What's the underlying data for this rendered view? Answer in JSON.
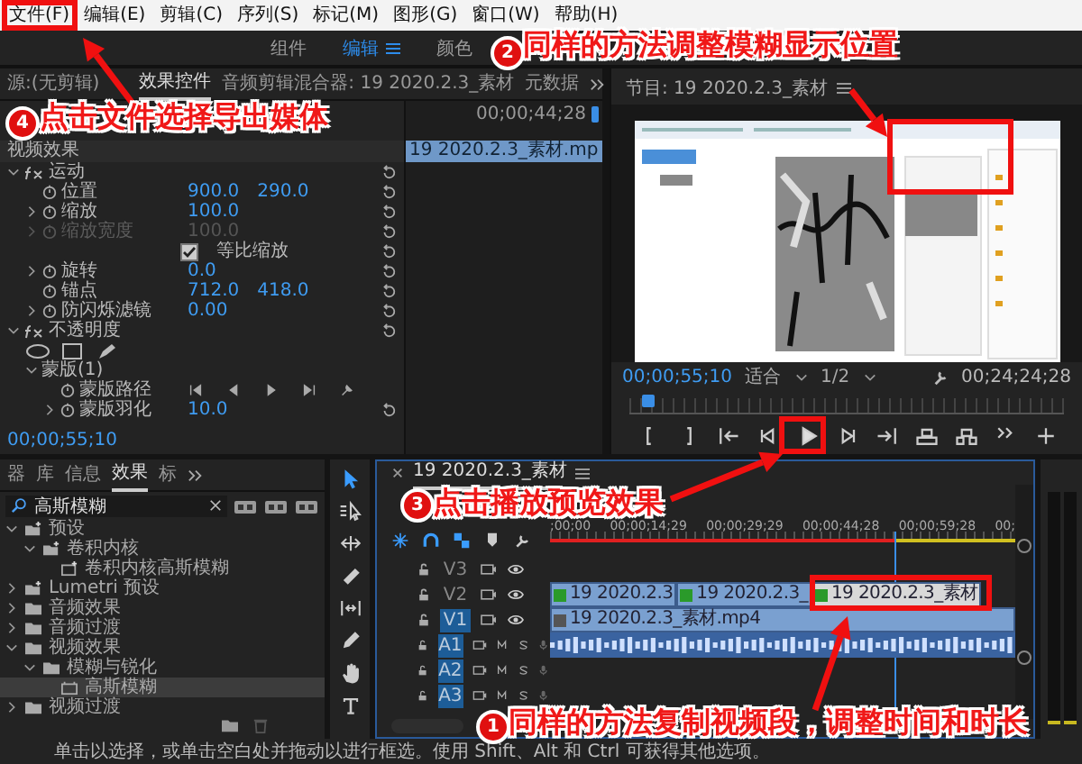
{
  "menu_bar": [
    "文件(F)",
    "编辑(E)",
    "剪辑(C)",
    "序列(S)",
    "标记(M)",
    "图形(G)",
    "窗口(W)",
    "帮助(H)"
  ],
  "workspaces": [
    {
      "label": "组件",
      "selected": false
    },
    {
      "label": "编辑",
      "selected": true
    },
    {
      "label": "颜色",
      "selected": false
    }
  ],
  "effect_controls": {
    "tabs": [
      {
        "label": "源:(无剪辑)",
        "selected": false
      },
      {
        "label": "效果控件",
        "selected": true
      },
      {
        "label": "音频剪辑混合器: 19 2020.2.3_素材",
        "selected": false
      },
      {
        "label": "元数据",
        "selected": false
      }
    ],
    "mini_timecode": "00;00;44;28",
    "mini_clip": "19 2020.2.3_素材.mp",
    "section": "视频效果",
    "effects": [
      {
        "kind": "group",
        "label": "运动",
        "expanded": true,
        "children": [
          {
            "kind": "param",
            "label": "位置",
            "values": [
              "900.0",
              "290.0"
            ],
            "expandable": false,
            "disabled": false
          },
          {
            "kind": "param",
            "label": "缩放",
            "values": [
              "100.0"
            ],
            "expandable": true,
            "disabled": false
          },
          {
            "kind": "param",
            "label": "缩放宽度",
            "values": [
              "100.0"
            ],
            "expandable": true,
            "disabled": true
          },
          {
            "kind": "checkbox",
            "label": "等比缩放",
            "checked": true
          },
          {
            "kind": "param",
            "label": "旋转",
            "values": [
              "0.0"
            ],
            "expandable": true,
            "disabled": false
          },
          {
            "kind": "param",
            "label": "锚点",
            "values": [
              "712.0",
              "418.0"
            ],
            "expandable": false,
            "disabled": false
          },
          {
            "kind": "param",
            "label": "防闪烁滤镜",
            "values": [
              "0.00"
            ],
            "expandable": true,
            "disabled": false
          }
        ]
      },
      {
        "kind": "group",
        "label": "不透明度",
        "expanded": true,
        "children": [
          {
            "kind": "mask-tools"
          },
          {
            "kind": "subgroup",
            "label": "蒙版(1)",
            "expanded": true,
            "children": [
              {
                "kind": "mask-path",
                "label": "蒙版路径"
              },
              {
                "kind": "param",
                "label": "蒙版羽化",
                "values": [
                  "10.0"
                ],
                "expandable": true,
                "disabled": false
              }
            ]
          }
        ]
      }
    ],
    "timecode": "00;00;55;10"
  },
  "program": {
    "title": "节目: 19 2020.2.3_素材",
    "timecode": "00;00;55;10",
    "zoom": "适合",
    "resolution": "1/2",
    "duration": "00;24;24;28",
    "level": 0.03
  },
  "effects_panel": {
    "tabs": [
      {
        "label": "器",
        "selected": false
      },
      {
        "label": "库",
        "selected": false
      },
      {
        "label": "信息",
        "selected": false
      },
      {
        "label": "效果",
        "selected": true
      },
      {
        "label": "标",
        "selected": false
      }
    ],
    "search": "高斯模糊",
    "tree": [
      {
        "label": "预设",
        "kind": "preset-folder",
        "expanded": true,
        "selected": false,
        "children": [
          {
            "label": "卷积内核",
            "kind": "preset-folder",
            "expanded": true,
            "selected": false,
            "children": [
              {
                "label": "卷积内核高斯模糊",
                "kind": "preset",
                "selected": false
              }
            ]
          }
        ]
      },
      {
        "label": "Lumetri 预设",
        "kind": "preset-folder",
        "expanded": false,
        "selected": false
      },
      {
        "label": "音频效果",
        "kind": "folder",
        "expanded": false,
        "selected": false
      },
      {
        "label": "音频过渡",
        "kind": "folder",
        "expanded": false,
        "selected": false
      },
      {
        "label": "视频效果",
        "kind": "folder",
        "expanded": true,
        "selected": false,
        "children": [
          {
            "label": "模糊与锐化",
            "kind": "folder",
            "expanded": true,
            "selected": false,
            "children": [
              {
                "label": "高斯模糊",
                "kind": "effect",
                "selected": true
              }
            ]
          }
        ]
      },
      {
        "label": "视频过渡",
        "kind": "folder",
        "expanded": false,
        "selected": false
      }
    ]
  },
  "tools": [
    {
      "kind": "selection",
      "selected": true
    },
    {
      "kind": "track-select",
      "selected": false
    },
    {
      "kind": "ripple",
      "selected": false
    },
    {
      "kind": "razor",
      "selected": false
    },
    {
      "kind": "slip",
      "selected": false
    },
    {
      "kind": "pen",
      "selected": false
    },
    {
      "kind": "hand",
      "selected": false
    },
    {
      "kind": "type",
      "selected": false
    }
  ],
  "timeline": {
    "tab": "19 2020.2.3_素材",
    "ruler": [
      ";00;00",
      "00;00;14;29",
      "00;00;29;29",
      "00;00;44;28",
      "00;00;59;28",
      "00;"
    ],
    "level": 0.74,
    "tracks": [
      {
        "name": "V3",
        "kind": "video",
        "targeted": false
      },
      {
        "name": "V2",
        "kind": "video",
        "targeted": false,
        "clips": [
          {
            "label": "19 2020.2.3",
            "selected": false
          },
          {
            "label": "19 2020.2.3_",
            "selected": false
          },
          {
            "label": "19 2020.2.3_素材",
            "selected": true
          }
        ]
      },
      {
        "name": "V1",
        "kind": "video",
        "targeted": true,
        "clips": [
          {
            "label": "19 2020.2.3_素材.mp4",
            "selected": false
          }
        ]
      },
      {
        "name": "A1",
        "kind": "audio",
        "targeted": true,
        "clips": [
          {
            "kind": "audio"
          }
        ]
      },
      {
        "name": "A2",
        "kind": "audio",
        "targeted": true
      },
      {
        "name": "A3",
        "kind": "audio",
        "targeted": true
      }
    ]
  },
  "status_bar": "单击以选择，或单击空白处并拖动以进行框选。使用 Shift、Alt 和 Ctrl 可获得其他选项。",
  "annotations": [
    {
      "number": "4",
      "text": "点击文件选择导出媒体"
    },
    {
      "number": "2",
      "text": "同样的方法调整模糊显示位置"
    },
    {
      "number": "3",
      "text": "点击播放预览效果"
    },
    {
      "number": "1",
      "text": "同样的方法复制视频段，调整时间和时长"
    }
  ]
}
